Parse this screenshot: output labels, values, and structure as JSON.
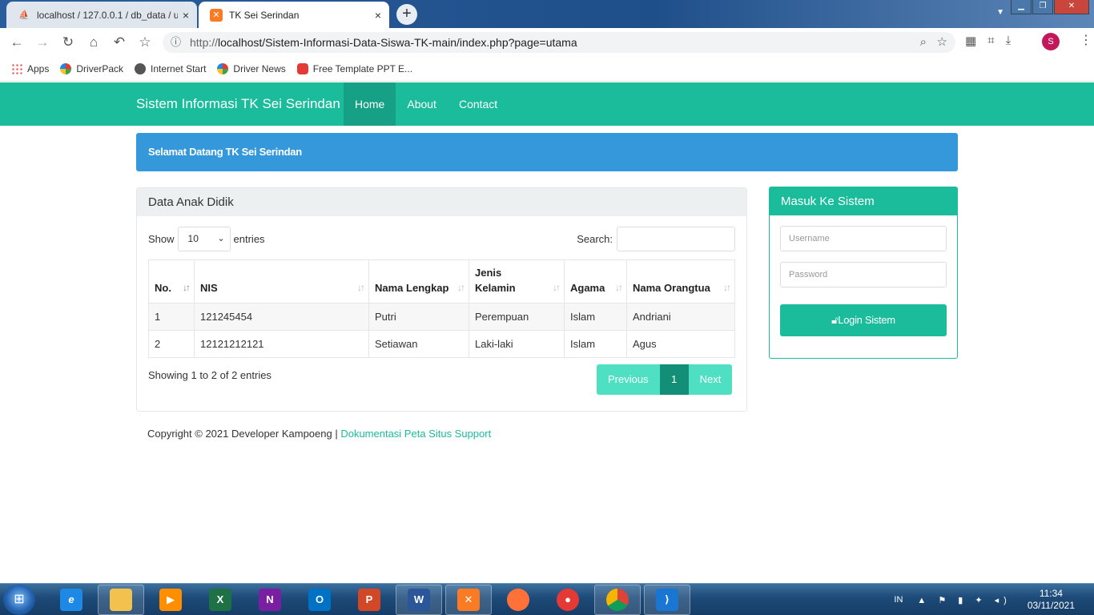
{
  "browser": {
    "tabs": [
      {
        "title": "localhost / 127.0.0.1 / db_data / u",
        "close": "×"
      },
      {
        "title": "TK Sei Serindan",
        "close": "×"
      }
    ],
    "new_tab": "+",
    "url_scheme": "http://",
    "url_rest": "localhost/Sistem-Informasi-Data-Siswa-TK-main/index.php?page=utama",
    "avatar_letter": "S",
    "bookmarks": [
      {
        "label": "Apps",
        "icon": "apps-grid-icon"
      },
      {
        "label": "DriverPack",
        "icon": "driverpack-icon"
      },
      {
        "label": "Internet Start",
        "icon": "globe-icon"
      },
      {
        "label": "Driver News",
        "icon": "driverpack-icon"
      },
      {
        "label": "Free Template PPT E...",
        "icon": "youtube-icon"
      }
    ]
  },
  "navbar": {
    "brand": "Sistem Informasi TK Sei Serindan",
    "links": [
      "Home",
      "About",
      "Contact"
    ]
  },
  "welcome": "Selamat Datang TK Sei Serindan",
  "data_panel": {
    "title": "Data Anak Didik",
    "show_label": "Show",
    "entries_value": "10",
    "entries_label": "entries",
    "search_label": "Search:",
    "columns": [
      "No.",
      "NIS",
      "Nama Lengkap",
      "Jenis Kelamin",
      "Agama",
      "Nama Orangtua"
    ],
    "rows": [
      [
        "1",
        "121245454",
        "Putri",
        "Perempuan",
        "Islam",
        "Andriani"
      ],
      [
        "2",
        "12121212121",
        "Setiawan",
        "Laki-laki",
        "Islam",
        "Agus"
      ]
    ],
    "info": "Showing 1 to 2 of 2 entries",
    "pager": {
      "previous": "Previous",
      "current": "1",
      "next": "Next"
    }
  },
  "login_panel": {
    "title": "Masuk Ke Sistem",
    "username_placeholder": "Username",
    "password_placeholder": "Password",
    "button": "Login Sistem"
  },
  "footer": {
    "text": "Copyright © 2021 Developer Kampoeng | ",
    "link": "Dokumentasi Peta Situs Support"
  },
  "taskbar": {
    "lang": "IN",
    "time": "11:34",
    "date": "03/11/2021"
  },
  "colors": {
    "primary": "#1abc9c",
    "primary_dark": "#16a085",
    "info": "#3498db"
  }
}
